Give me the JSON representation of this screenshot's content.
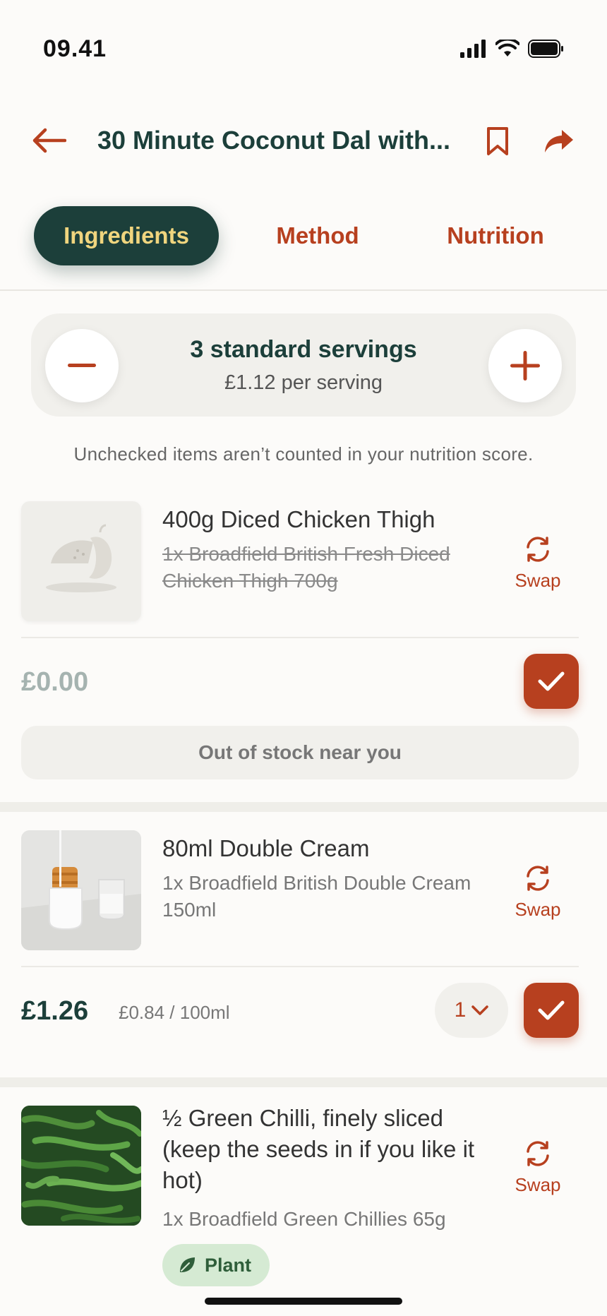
{
  "status_bar": {
    "time": "09.41"
  },
  "header": {
    "title": "30 Minute Coconut Dal with..."
  },
  "tabs": [
    {
      "label": "Ingredients",
      "active": true
    },
    {
      "label": "Method",
      "active": false
    },
    {
      "label": "Nutrition",
      "active": false
    }
  ],
  "servings": {
    "title": "3 standard servings",
    "per_serving": "£1.12 per serving"
  },
  "note": "Unchecked items aren’t counted in your nutrition score.",
  "items": [
    {
      "name": "400g Diced Chicken Thigh",
      "product": "1x Broadfield British Fresh Diced Chicken Thigh 700g",
      "product_struck": true,
      "swap_label": "Swap",
      "price": "£0.00",
      "checked": true,
      "out_of_stock": "Out of stock near you"
    },
    {
      "name": "80ml Double Cream",
      "product": "1x Broadfield British Double Cream 150ml",
      "swap_label": "Swap",
      "price": "£1.26",
      "unit_price": "£0.84 / 100ml",
      "quantity": "1",
      "checked": true
    },
    {
      "name": "½ Green Chilli, finely sliced (keep the seeds in if you like it hot)",
      "product": "1x Broadfield Green Chillies 65g",
      "swap_label": "Swap",
      "badge": "Plant"
    }
  ],
  "colors": {
    "brand_dark": "#1c3f3a",
    "accent": "#b7401f",
    "tab_active_text": "#f0d57e"
  }
}
